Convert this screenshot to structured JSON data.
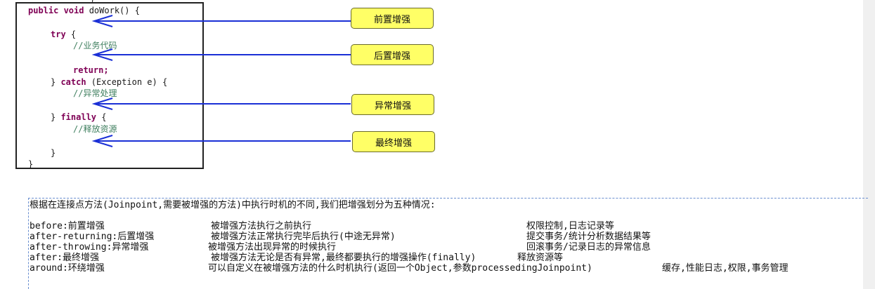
{
  "top_fragment": "}",
  "code": {
    "l1_pre": "public void ",
    "l1_rest": "doWork() {",
    "try_kw": "try",
    "try_rest": " {",
    "comment_business": "//业务代码",
    "return_kw": "return;",
    "catch_pre": "} ",
    "catch_kw": "catch",
    "catch_rest": " (Exception e) {",
    "comment_exception": "//异常处理",
    "finally_pre": "} ",
    "finally_kw": "finally",
    "finally_rest": " {",
    "comment_release": "//释放资源",
    "inner_close": "}",
    "outer_close": "}"
  },
  "badges": {
    "before": "前置增强",
    "after_returning": "后置增强",
    "after_throwing": "异常增强",
    "after": "最终增强"
  },
  "notes": {
    "intro": "根据在连接点方法(Joinpoint,需要被增强的方法)中执行时机的不同,我们把增强划分为五种情况:",
    "rows": [
      {
        "type": "before:前置增强",
        "desc": "被增强方法执行之前执行",
        "use": "权限控制,日志记录等"
      },
      {
        "type": "after-returning:后置增强",
        "desc": "被增强方法正常执行完毕后执行(中途无异常)",
        "use": "提交事务/统计分析数据结果等"
      },
      {
        "type": "after-throwing:异常增强",
        "desc": "被增强方法出现异常的时候执行",
        "use": "回滚事务/记录日志的异常信息"
      },
      {
        "type": "after:最终增强",
        "desc": "被增强方法无论是否有异常,最终都要执行的增强操作(finally)",
        "use": "释放资源等"
      },
      {
        "type": "around:环绕增强",
        "desc": "可以自定义在被增强方法的什么时机执行(返回一个Object,参数processedingJoinpoint)",
        "use": "缓存,性能日志,权限,事务管理"
      }
    ]
  },
  "colors": {
    "arrow": "#1a2fd6",
    "badge_fill": "#ffff66",
    "keyword": "#7f0055",
    "comment": "#3f7f5f"
  }
}
